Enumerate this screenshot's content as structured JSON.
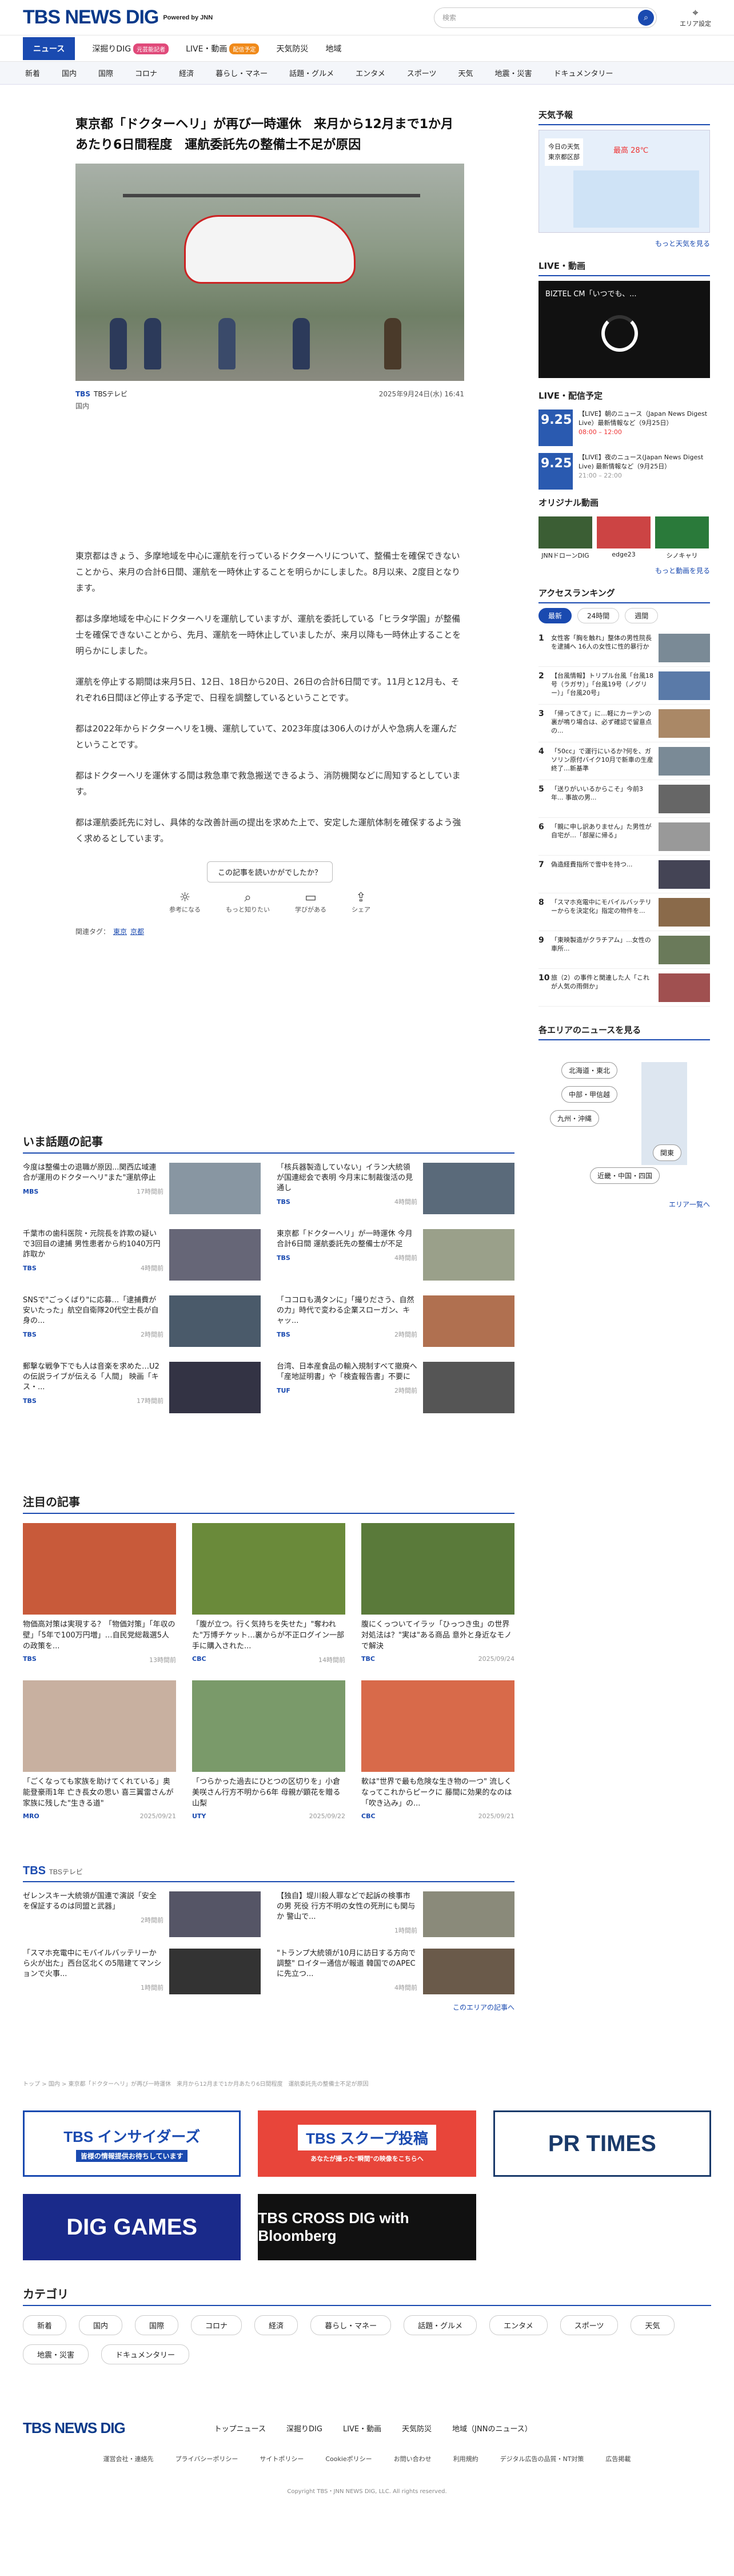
{
  "header": {
    "logo": "TBS NEWS DIG",
    "powered": "Powered by JNN",
    "search_placeholder": "検索",
    "area_label": "エリア設定"
  },
  "nav": {
    "items": [
      "ニュース",
      "深掘りDIG",
      "LIVE・動画",
      "天気防災",
      "地域"
    ],
    "badge_dig": "元芸能記者",
    "badge_live": "配信予定"
  },
  "subnav": [
    "新着",
    "国内",
    "国際",
    "コロナ",
    "経済",
    "暮らし・マネー",
    "話題・グルメ",
    "エンタメ",
    "スポーツ",
    "天気",
    "地震・災害",
    "ドキュメンタリー"
  ],
  "article": {
    "title": "東京都「ドクターヘリ」が再び一時運休　来月から12月まで1か月あたり6日間程度　運航委託先の整備士不足が原因",
    "source": "TBSテレビ",
    "date": "2025年9月24日(水) 16:41",
    "category": "国内",
    "paragraphs": [
      "東京都はきょう、多摩地域を中心に運航を行っているドクターヘリについて、整備士を確保できないことから、来月の合計6日間、運航を一時休止することを明らかにしました。8月以来、2度目となります。",
      "都は多摩地域を中心にドクターヘリを運航していますが、運航を委託している「ヒラタ学園」が整備士を確保できないことから、先月、運航を一時休止していましたが、来月以降も一時休止することを明らかにしました。",
      "運航を停止する期間は来月5日、12日、18日から20日、26日の合計6日間です。11月と12月も、それぞれ6日間ほど停止する予定で、日程を調整しているということです。",
      "都は2022年からドクターヘリを1機、運航していて、2023年度は306人のけが人や急病人を運んだということです。",
      "都はドクターヘリを運休する間は救急車で救急搬送できるよう、消防機関などに周知するとしています。",
      "都は運航委託先に対し、具体的な改善計画の提出を求めた上で、安定した運航体制を確保するよう強く求めるとしています。"
    ],
    "question": "この記事を読いかがでしたか？",
    "reactions": [
      "参考になる",
      "もっと知りたい",
      "学びがある",
      "シェア"
    ],
    "tags_label": "関連タグ：",
    "tags": [
      "東京",
      "京都"
    ]
  },
  "side": {
    "weather_title": "天気予報",
    "weather_today": "今日の天気",
    "weather_area": "東京都区部",
    "weather_high": "最高 28℃",
    "weather_more": "もっと天気を見る",
    "live_title": "LIVE・動画",
    "live_video_title": "BIZTEL CM「いつでも、...",
    "schedule_title": "LIVE・配信予定",
    "schedule": [
      {
        "date": "9.25",
        "text": "【LIVE】朝のニュース（Japan News Digest Live）最新情報など（9月25日）",
        "time": "08:00 – 12:00"
      },
      {
        "date": "9.25",
        "text": "【LIVE】夜のニュース(Japan News Digest Live) 最新情報など（9月25日）",
        "time": "21:00 – 22:00"
      }
    ],
    "original_title": "オリジナル動画",
    "original": [
      "JNNドローンDIG",
      "edge23",
      "シノキャリ"
    ],
    "original_more": "もっと動画を見る",
    "ranking_title": "アクセスランキング",
    "ranking_tabs": [
      "最新",
      "24時間",
      "週間"
    ],
    "ranking": [
      "女性客「胸を触れ」整体の男性院長を逮捕へ 16人の女性に性的暴行か",
      "【台風情報】トリプル台風「台風18号（ラガサ）」「台風19号（ノグリー）」「台風20号」",
      "「帰ってきて」に…軽にカーテンの裏が鳴り場合は、必ず確認で留意点の...",
      "「50cc」で運行にいるか?何を、ガソリン原付バイク10月で新車の生産終了…新基準",
      "「送りがいいるからこそ」今前3年... 事故の男...",
      "「親に申し訳ありません」た男性が自宅が…「部屋に帰る」",
      "偽造経費指所で雪中を持つ...",
      "「スマホ充電中にモバイルバッテリーからを決定化」指定の物件を...",
      "「東映製造がクラチアム」...女性の車所...",
      "旅（2）の事件と関連した人「これが人気の雨倒か」"
    ],
    "area_title": "各エリアのニュースを見る",
    "area_buttons": [
      "北海道・東北",
      "中部・甲信越",
      "九州・沖縄",
      "関東",
      "近畿・中国・四国"
    ],
    "area_more": "エリア一覧へ"
  },
  "hot": {
    "title": "いま話題の記事",
    "items": [
      {
        "t": "今度は整備士の退職が原因...関西広域連合が運用のドクターヘリ\"また\"運航停止",
        "s": "MBS",
        "d": "17時間前"
      },
      {
        "t": "「核兵器製造していない」イラン大統領が国連総会で表明 今月末に制裁復活の見通し",
        "s": "TBS",
        "d": "4時間前"
      },
      {
        "t": "千葉市の歯科医院・元院長を詐欺の疑いで3回目の逮捕 男性患者から約1040万円詐取か",
        "s": "TBS",
        "d": "4時間前"
      },
      {
        "t": "東京都「ドクターヘリ」が一時運休 今月合計6日間 運航委託先の整備士が不足",
        "s": "TBS",
        "d": "4時間前"
      },
      {
        "t": "SNSで\"ごっくばり\"に応募…「逮捕費が安いたった」航空自衛隊20代空士長が自身の...",
        "s": "TBS",
        "d": "2時間前"
      },
      {
        "t": "「ココロも満タンに」「撮りださう、自然の力」時代で変わる企業スローガン、キャッ...",
        "s": "TBS",
        "d": "2時間前"
      },
      {
        "t": "郵撃な戦争下でも人は音楽を求めた…U2の伝説ライブが伝える「人間」 映画「キス・...",
        "s": "TBS",
        "d": "17時間前"
      },
      {
        "t": "台湾、日本産食品の輸入規制すべて撤廃へ「産地証明書」や「検査報告書」不要に",
        "s": "TUF",
        "d": "2時間前"
      }
    ]
  },
  "featured": {
    "title": "注目の記事",
    "items": [
      {
        "t": "物価高対策は実現する？「物価対策」「年収の壁」「5年で100万円増」…自民党総裁選5人の政策を...",
        "s": "TBS",
        "d": "13時間前"
      },
      {
        "t": "「腹が立つ。行く気持ちを失せた」\"奪われた\"万博チケット…裏からが不正ログイン一部手に購入された...",
        "s": "CBC",
        "d": "14時間前"
      },
      {
        "t": "腹にくっついてイラッ「ひっつき虫」の世界 対処法は？\"実は\"ある商品 意外と身近なモノで解決",
        "s": "TBC",
        "d": "2025/09/24"
      },
      {
        "t": "「ごくなっても家族を助けてくれている」奥能登豪雨1年 亡き長女の思い 喜三翼雷さんが家族に残した\"生きる道\"",
        "s": "MRO",
        "d": "2025/09/21"
      },
      {
        "t": "「つらかった過去にひとつの区切りを」小倉美咲さん行方不明から6年 母親が顕花を贈る 山梨",
        "s": "UTY",
        "d": "2025/09/22"
      },
      {
        "t": "軟は\"世界で最も危険な生き物の一つ\" 流しくなってこれからピークに 藤間に効果的なのは「吹き込み」の...",
        "s": "CBC",
        "d": "2025/09/21"
      }
    ]
  },
  "tbs": {
    "title": "TBS",
    "sub": "TBSテレビ",
    "items": [
      {
        "t": "ゼレンスキー大統領が国連で演説「安全を保証するのは同盟と武器」",
        "d": "2時間前"
      },
      {
        "t": "【独自】堤川殺人罪などで起訴の検事市の男 死役 行方不明の女性の死刑にも関与か 警山で...",
        "d": "1時間前"
      },
      {
        "t": "「スマホ充電中にモバイルバッテリーから火が出た」西台区北くの5階建てマンションで火事...",
        "d": "1時間前"
      },
      {
        "t": "\"トランプ大統領が10月に訪日する方向で調整\" ロイター通信が報道 韓国でのAPECに先立つ...",
        "d": "4時間前"
      }
    ],
    "more": "このエリアの記事へ"
  },
  "breadcrumb": "トップ > 国内 > 東京都「ドクターヘリ」が再び一時運休　来月から12月まで1か月あたり6日間程度　運航委託先の整備士不足が原因",
  "banners": [
    "TBS インサイダーズ",
    "TBS スクープ投稿",
    "PR TIMES",
    "DIG GAMES",
    "TBS CROSS DIG with Bloomberg"
  ],
  "banner_subs": [
    "皆様の情報提供お待ちしています",
    "あなたが撮った\"瞬間\"の映像をこちらへ"
  ],
  "category": {
    "title": "カテゴリ",
    "items": [
      "新着",
      "国内",
      "国際",
      "コロナ",
      "経済",
      "暮らし・マネー",
      "話題・グルメ",
      "エンタメ",
      "スポーツ",
      "天気",
      "地震・災害",
      "ドキュメンタリー"
    ]
  },
  "footer": {
    "nav": [
      "トップニュース",
      "深掘りDIG",
      "LIVE・動画",
      "天気防災",
      "地域（JNNのニュース）"
    ],
    "links": [
      "運営会社・連絡先",
      "プライバシーポリシー",
      "サイトポリシー",
      "Cookieポリシー",
      "お問い合わせ",
      "利用規約",
      "デジタル広告の品質・NT対策",
      "広告掲載"
    ],
    "copyright": "Copyright TBS・JNN NEWS DIG, LLC. All rights reserved."
  }
}
